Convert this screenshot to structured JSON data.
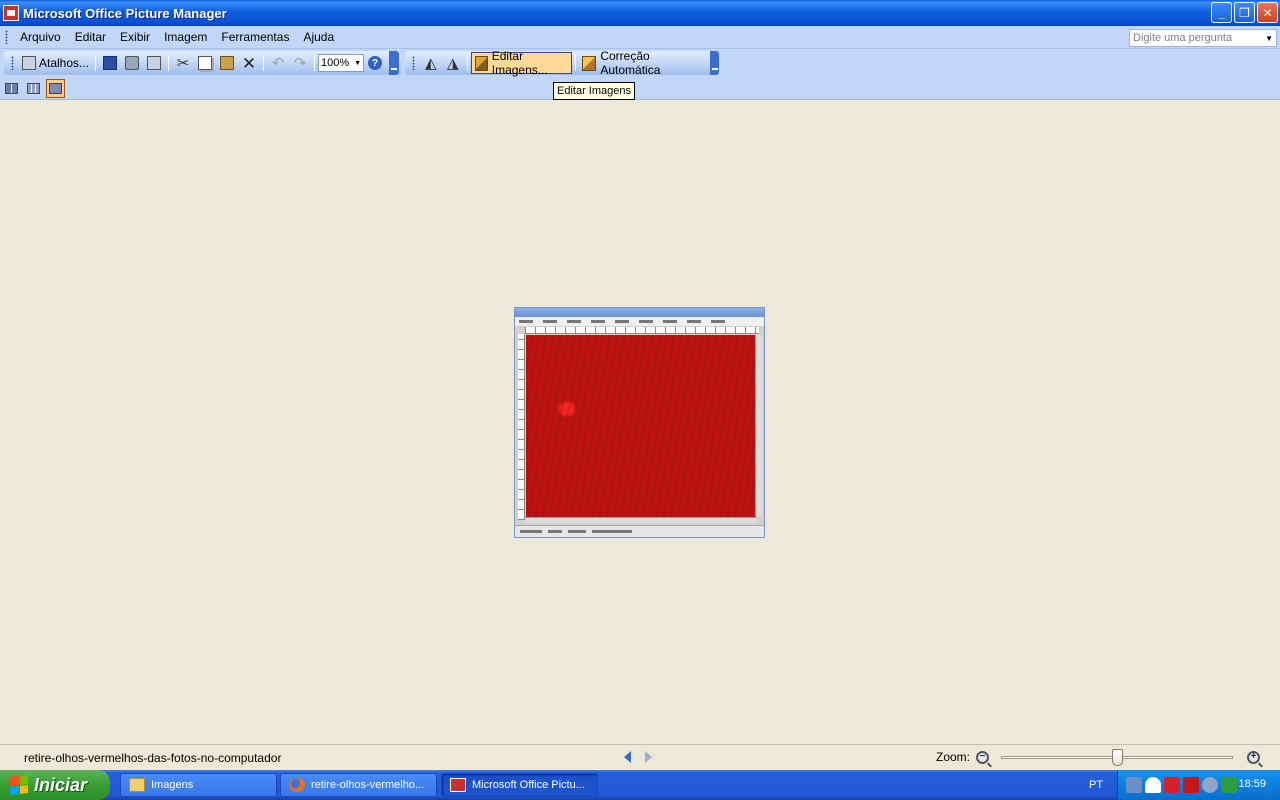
{
  "window": {
    "title": "Microsoft Office Picture Manager"
  },
  "menu": [
    {
      "label": "Arquivo"
    },
    {
      "label": "Editar"
    },
    {
      "label": "Exibir"
    },
    {
      "label": "Imagem"
    },
    {
      "label": "Ferramentas"
    },
    {
      "label": "Ajuda"
    }
  ],
  "help_box": {
    "placeholder": "Digite uma pergunta"
  },
  "toolbar": {
    "shortcuts_label": "Atalhos...",
    "zoom_value": "100%",
    "edit_images_label": "Editar Imagens...",
    "auto_correct_label": "Correção Automática"
  },
  "tooltip": "Editar Imagens",
  "status": {
    "filename": "retire-olhos-vermelhos-das-fotos-no-computador",
    "zoom_label": "Zoom:",
    "zoom_level": 0.5
  },
  "taskbar": {
    "start_label": "Iniciar",
    "tasks": [
      {
        "label": "Imagens",
        "icon": "folder-icon"
      },
      {
        "label": "retire-olhos-vermelho...",
        "icon": "firefox-icon"
      },
      {
        "label": "Microsoft Office Pictu...",
        "icon": "picture-manager-icon"
      }
    ],
    "language": "PT",
    "clock": "18:59"
  }
}
